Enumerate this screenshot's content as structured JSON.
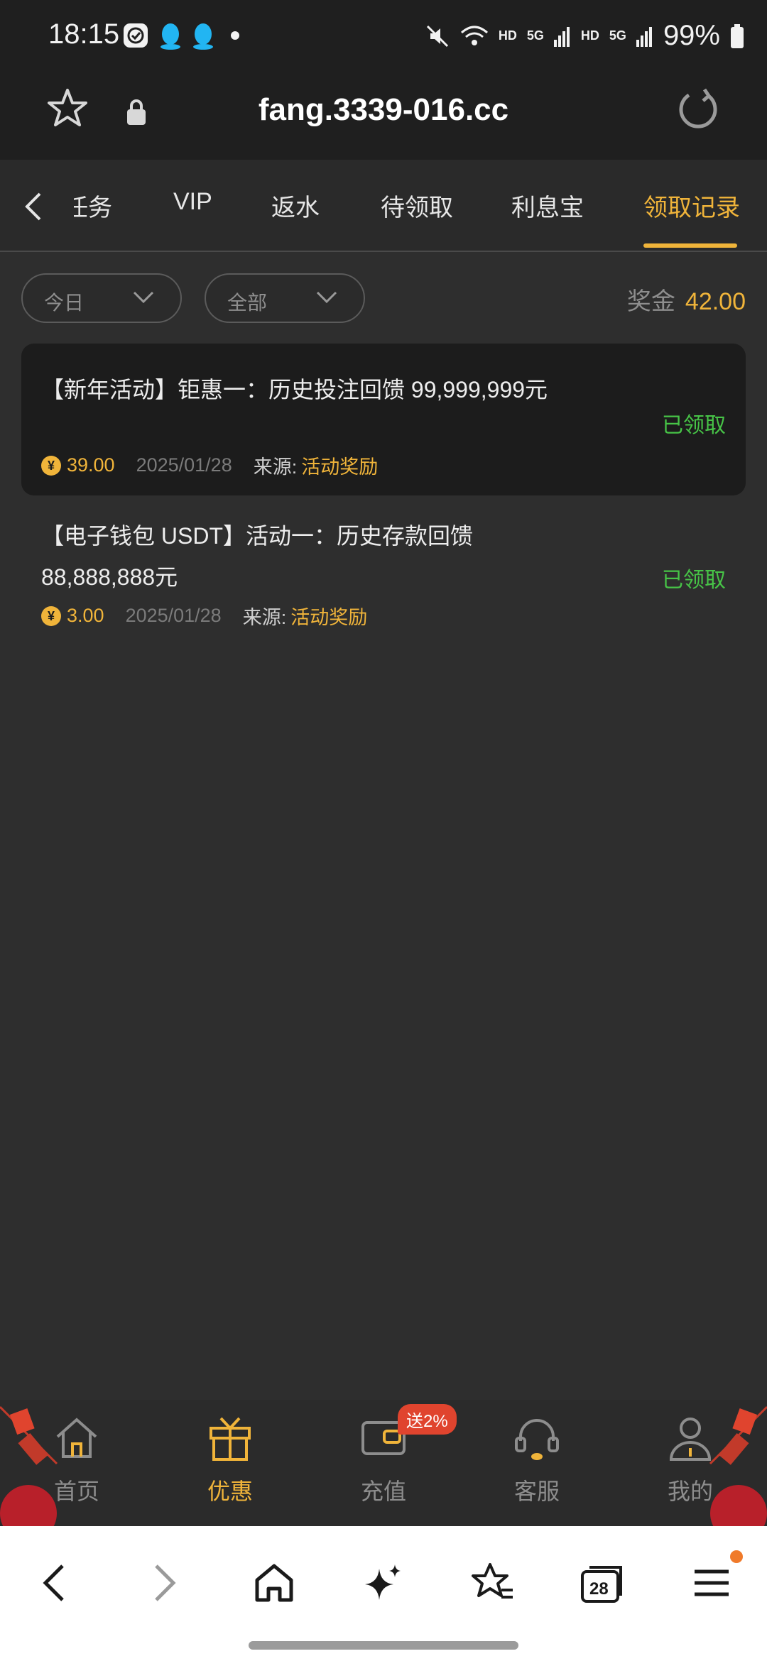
{
  "status_bar": {
    "time": "18:15",
    "battery": "99%",
    "network_labels": [
      "HD",
      "5G",
      "HD",
      "5G"
    ],
    "icons": [
      "clock-app-icon",
      "qq-icon",
      "qq-icon",
      "notification-dot-icon",
      "mute-icon",
      "wifi-icon",
      "signal-icon",
      "signal-icon",
      "battery-icon"
    ]
  },
  "url_bar": {
    "url": "fang.3339-016.cc",
    "icons": [
      "bookmark-star-icon",
      "lock-icon",
      "reload-icon"
    ]
  },
  "tabs": {
    "items": [
      {
        "label": "任务"
      },
      {
        "label": "VIP"
      },
      {
        "label": "返水"
      },
      {
        "label": "待领取"
      },
      {
        "label": "利息宝"
      },
      {
        "label": "领取记录"
      }
    ],
    "active_index": 5
  },
  "filters": {
    "date_filter": "今日",
    "type_filter": "全部",
    "bonus_label": "奖金",
    "bonus_value": "42.00"
  },
  "records": [
    {
      "title": "【新年活动】钜惠一：历史投注回馈 99,999,999元",
      "status": "已领取",
      "amount": "39.00",
      "date": "2025/01/28",
      "source_label": "来源:",
      "source_value": "活动奖励"
    },
    {
      "title": "【电子钱包 USDT】活动一：历史存款回馈 88,888,888元",
      "status": "已领取",
      "amount": "3.00",
      "date": "2025/01/28",
      "source_label": "来源:",
      "source_value": "活动奖励"
    }
  ],
  "bottom_nav": {
    "items": [
      {
        "label": "首页",
        "icon": "home-icon"
      },
      {
        "label": "优惠",
        "icon": "gift-icon"
      },
      {
        "label": "充值",
        "icon": "wallet-icon"
      },
      {
        "label": "客服",
        "icon": "headset-icon"
      },
      {
        "label": "我的",
        "icon": "user-icon"
      }
    ],
    "active_index": 1,
    "promo_badge": "送2%"
  },
  "browser_nav": {
    "tabs_count": "28",
    "icons": [
      "back-icon",
      "forward-icon",
      "home-icon",
      "ai-sparkle-icon",
      "bookmarks-icon",
      "tabs-icon",
      "menu-icon"
    ]
  },
  "colors": {
    "accent": "#f0b43a",
    "success": "#47c447",
    "background": "#2e2e2e",
    "card": "#1c1c1c"
  }
}
